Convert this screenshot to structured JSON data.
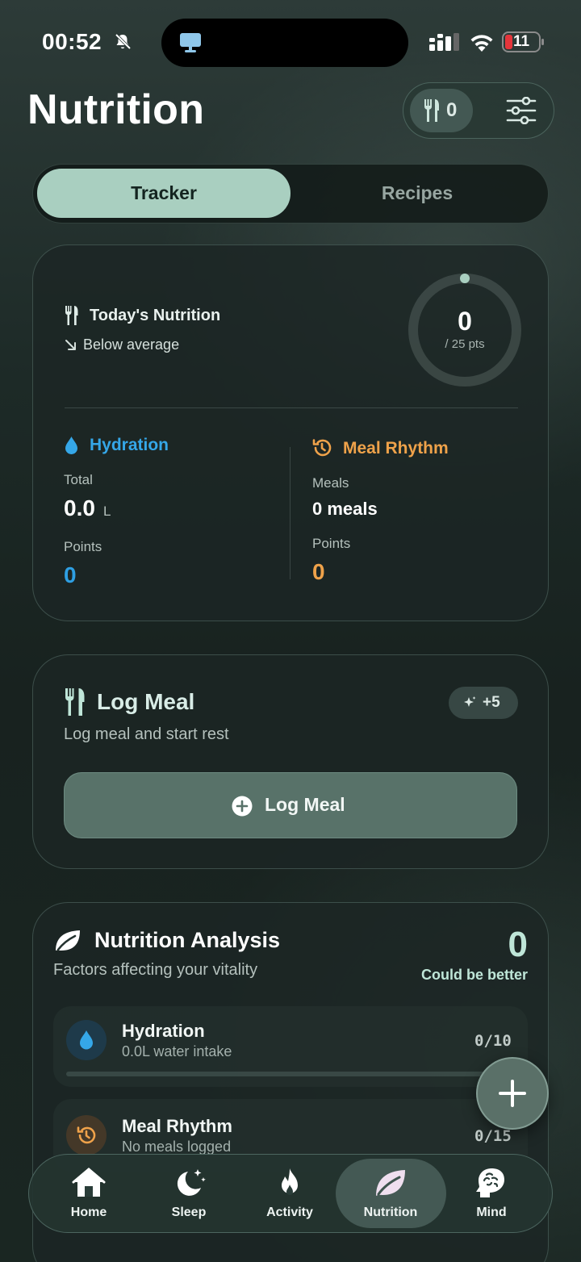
{
  "status_bar": {
    "time": "00:52",
    "battery": "11"
  },
  "header": {
    "title": "Nutrition",
    "meal_count": "0"
  },
  "segmented": {
    "tabs": [
      {
        "label": "Tracker",
        "active": true
      },
      {
        "label": "Recipes",
        "active": false
      }
    ]
  },
  "today": {
    "title": "Today's Nutrition",
    "trend": "Below average",
    "points": "0",
    "points_max": "/ 25 pts",
    "progress_fraction": 0,
    "hydration": {
      "title": "Hydration",
      "total_label": "Total",
      "total_value": "0.0",
      "total_unit": "L",
      "points_label": "Points",
      "points_value": "0"
    },
    "meal_rhythm": {
      "title": "Meal Rhythm",
      "meals_label": "Meals",
      "meals_value": "0 meals",
      "points_label": "Points",
      "points_value": "0"
    }
  },
  "log_meal": {
    "title": "Log Meal",
    "subtitle": "Log meal and start rest",
    "bonus": "+5",
    "button_label": "Log Meal"
  },
  "analysis": {
    "title": "Nutrition Analysis",
    "subtitle": "Factors affecting your vitality",
    "score": "0",
    "score_label": "Could be better",
    "rows": [
      {
        "title": "Hydration",
        "subtitle": "0.0L water intake",
        "score": "0/10",
        "progress": 0
      },
      {
        "title": "Meal Rhythm",
        "subtitle": "No meals logged",
        "score": "0/15",
        "progress": 0
      }
    ]
  },
  "tabbar": {
    "items": [
      {
        "label": "Home",
        "icon": "home-icon"
      },
      {
        "label": "Sleep",
        "icon": "moon-icon"
      },
      {
        "label": "Activity",
        "icon": "flame-icon"
      },
      {
        "label": "Nutrition",
        "icon": "leaf-icon",
        "active": true
      },
      {
        "label": "Mind",
        "icon": "brain-icon"
      }
    ]
  },
  "colors": {
    "hydration": "#35a7e8",
    "meal_rhythm": "#efa24a",
    "accent": "#a9cfc0"
  }
}
